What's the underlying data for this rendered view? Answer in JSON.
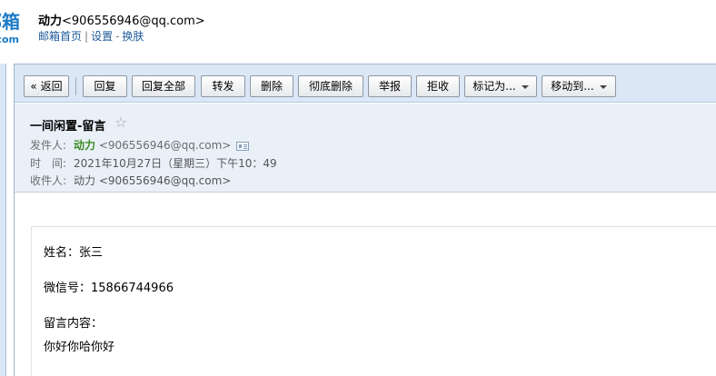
{
  "header": {
    "logo_main": "邮箱",
    "logo_sub": ".com",
    "nickname": "动力",
    "email": "<906556946@qq.com>",
    "links": [
      "邮箱首页",
      "设置",
      "换肤"
    ],
    "link_sep_1": "|",
    "link_sep_2": "-"
  },
  "toolbar": {
    "back": "« 返回",
    "reply": "回复",
    "reply_all": "回复全部",
    "forward": "转发",
    "delete": "删除",
    "delete_permanently": "彻底删除",
    "report": "举报",
    "reject": "拒收",
    "mark_as": "标记为...",
    "move_to": "移动到..."
  },
  "mail": {
    "subject": "一间闲置-留言",
    "star": "☆",
    "from_label": "发件人:",
    "from_name": "动力",
    "from_addr": "<906556946@qq.com>",
    "time_label": "时　间:",
    "time_value": "2021年10月27日（星期三）下午10：49",
    "to_label": "收件人:",
    "to_value": "动力 <906556946@qq.com>"
  },
  "body": {
    "name_line": "姓名：张三",
    "wechat_line": "微信号：15866744966",
    "message_label": "留言内容：",
    "message_text": "你好你哈你好"
  }
}
